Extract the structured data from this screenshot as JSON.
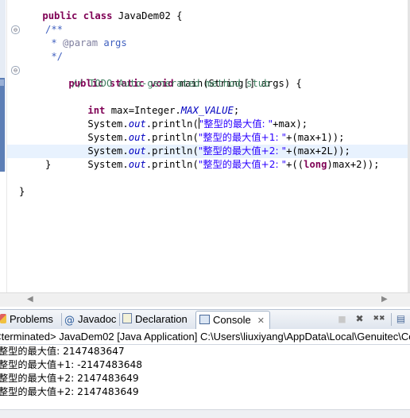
{
  "editor": {
    "lines": {
      "l1": {
        "kw1": "public",
        "sp1": " ",
        "kw2": "class",
        "rest": " JavaDem02 {"
      },
      "l2": {
        "text": "/**"
      },
      "l3": {
        "star": " * ",
        "tag": "@param",
        "rest": " args"
      },
      "l4": {
        "text": " */"
      },
      "l5": {
        "kw1": "public",
        "sp1": " ",
        "kw2": "static",
        "sp2": " ",
        "kw3": "void",
        "rest": " main(String[] args) {"
      },
      "l6": {
        "text": "// TODO Auto-generated method stub"
      },
      "l7": {
        "kw": "int",
        "pre": " max=Integer.",
        "field": "MAX_VALUE",
        "post": ";"
      },
      "l8": {
        "pre": "System.",
        "field": "out",
        "mid": ".println(",
        "str": "\"整型的最大值: \"",
        "post": "+max);"
      },
      "l9": {
        "pre": "System.",
        "field": "out",
        "mid": ".println(",
        "str": "\"整型的最大值+1: \"",
        "post": "+(max+1));"
      },
      "l10": {
        "pre": "System.",
        "field": "out",
        "mid": ".println(",
        "str": "\"整型的最大值+2: \"",
        "post": "+(max+2L));"
      },
      "l11": {
        "pre": "System.",
        "field": "out",
        "mid": ".println(",
        "str": "\"整型的最大值+2: \"",
        "post1": "+((",
        "kw": "long",
        "post2": ")max+2));"
      },
      "l12": {
        "text": "}"
      },
      "l13": {
        "text": "}"
      }
    }
  },
  "tabs": {
    "problems": "Problems",
    "javadoc": "Javadoc",
    "declaration": "Declaration",
    "console": "Console",
    "console_close": "✕"
  },
  "console": {
    "header": "<terminated> JavaDem02 [Java Application] C:\\Users\\liuxiyang\\AppData\\Local\\Genuitec\\Co",
    "output": [
      "整型的最大值: 2147483647",
      "整型的最大值+1: -2147483648",
      "整型的最大值+2: 2147483649",
      "整型的最大值+2: 2147483649"
    ]
  },
  "icons": {
    "fold_minus": "⊖",
    "scroll_left": "◀",
    "scroll_right": "▶",
    "terminate": "■",
    "remove": "✖",
    "remove_all": "✖✖",
    "new_console": "▤"
  },
  "colors": {
    "keyword": "#7f0055",
    "comment": "#3f7f5f",
    "javadoc": "#3f5fbf",
    "string": "#2a00ff",
    "static_field": "#0000c0",
    "current_line": "#e8f2fe"
  }
}
